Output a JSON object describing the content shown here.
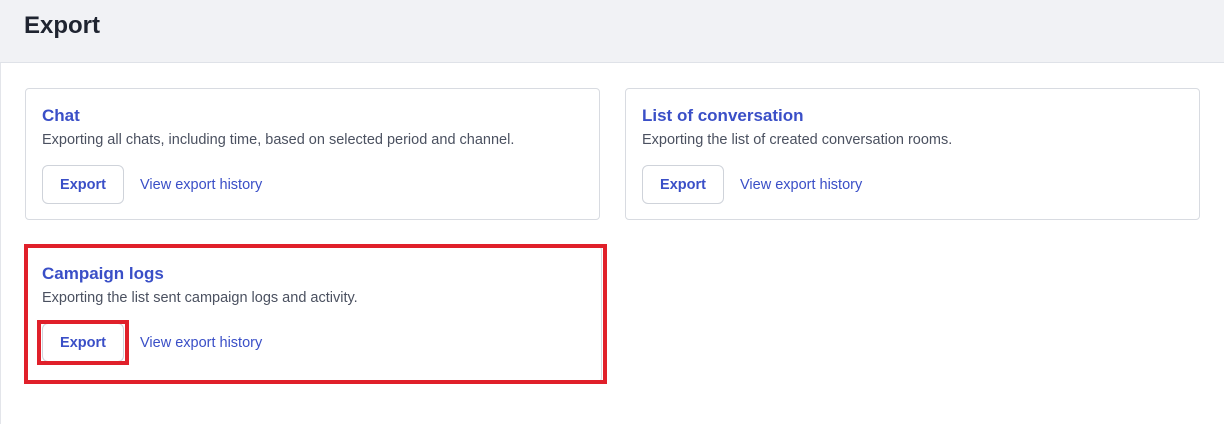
{
  "page": {
    "title": "Export"
  },
  "cards": [
    {
      "title": "Chat",
      "description": "Exporting all chats, including time, based on selected period and channel.",
      "export_label": "Export",
      "history_label": "View export history"
    },
    {
      "title": "List of conversation",
      "description": "Exporting the list of created conversation rooms.",
      "export_label": "Export",
      "history_label": "View export history"
    },
    {
      "title": "Campaign logs",
      "description": "Exporting the list sent campaign logs and activity.",
      "export_label": "Export",
      "history_label": "View export history"
    }
  ],
  "colors": {
    "accent": "#3a4fc7",
    "highlight": "#e0202a",
    "header_bg": "#f1f2f5"
  }
}
